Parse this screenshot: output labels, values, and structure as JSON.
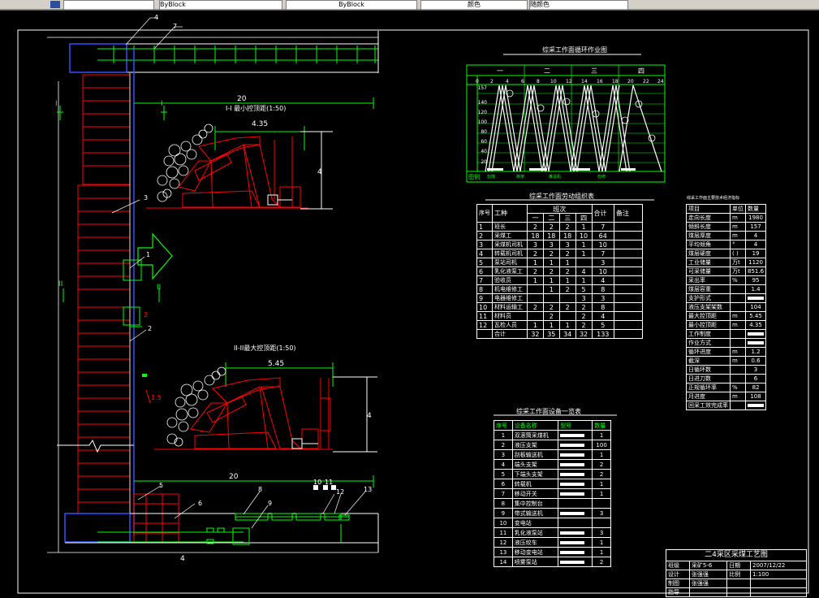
{
  "toolbar": {
    "combo1": "ByBlock",
    "combo2": "ByBlock",
    "combo3": "颜色",
    "combo4": "随颜色"
  },
  "drawing": {
    "dim_top": "20",
    "dim_bottom": "20",
    "dim_left_bottom": "4",
    "dim_small_h": "4",
    "dim_large_h": "4",
    "dim_small_w": "4.35",
    "dim_large_w": "5.45",
    "dim_small_gap": "2",
    "dim_gap2": "1.5",
    "section1_title": "I-I 最小控顶距(1:50)",
    "section2_title": "II-II最大控顶距(1:50)",
    "section1_mark_l": "I",
    "section1_mark_r": "I",
    "section2_mark_l": "II",
    "section2_mark_r": "II",
    "callouts": [
      "4",
      "7",
      "3",
      "1",
      "2",
      "5",
      "6",
      "8",
      "9",
      "10",
      "11",
      "12",
      "13"
    ]
  },
  "cycle_chart": {
    "title": "综采工作面循环作业图",
    "shifts": [
      "一",
      "二",
      "三",
      "四"
    ],
    "hours": [
      "0",
      "2",
      "4",
      "6",
      "8",
      "10",
      "12",
      "14",
      "16",
      "18",
      "20",
      "22",
      "24"
    ],
    "y_ticks": [
      "157",
      "140",
      "120",
      "100",
      "80",
      "60",
      "40",
      "20"
    ],
    "legend_label": "图例",
    "legend_items": [
      "割煤",
      "移架",
      "推溜机",
      "检修"
    ]
  },
  "labor_table": {
    "title": "综采工作面劳动组织表",
    "header": {
      "seq": "序号",
      "job": "工种",
      "shifts": "班次",
      "shift_cols": [
        "一",
        "二",
        "三",
        "四"
      ],
      "total": "合计",
      "note": "备注"
    },
    "rows": [
      [
        "1",
        "班长",
        "2",
        "2",
        "2",
        "1",
        "7"
      ],
      [
        "2",
        "采煤工",
        "18",
        "18",
        "18",
        "10",
        "64"
      ],
      [
        "3",
        "采煤机司机",
        "3",
        "3",
        "3",
        "1",
        "10"
      ],
      [
        "4",
        "转载机司机",
        "2",
        "2",
        "2",
        "1",
        "7"
      ],
      [
        "5",
        "泵站司机",
        "1",
        "1",
        "1",
        "",
        "3"
      ],
      [
        "6",
        "乳化液泵工",
        "2",
        "2",
        "2",
        "4",
        "10"
      ],
      [
        "7",
        "验收员",
        "1",
        "1",
        "1",
        "1",
        "4"
      ],
      [
        "8",
        "机电维修工",
        "",
        "1",
        "2",
        "5",
        "8"
      ],
      [
        "9",
        "电器维修工",
        "",
        "",
        "",
        "3",
        "3"
      ],
      [
        "10",
        "材料运输工",
        "2",
        "2",
        "2",
        "2",
        "8"
      ],
      [
        "11",
        "材料员",
        "",
        "2",
        "",
        "2",
        "4"
      ],
      [
        "12",
        "瓦检人员",
        "1",
        "1",
        "1",
        "2",
        "5"
      ],
      [
        "",
        "合计",
        "32",
        "35",
        "34",
        "32",
        "133"
      ]
    ]
  },
  "tech_table": {
    "title": "综采工作面主要技术经济指标",
    "header": [
      "项目",
      "单位",
      "数量"
    ],
    "rows": [
      [
        "走向长度",
        "m",
        "1980"
      ],
      [
        "倾斜长度",
        "m",
        "157"
      ],
      [
        "煤层厚度",
        "m",
        "4"
      ],
      [
        "平均倾角",
        "°",
        "4"
      ],
      [
        "煤层硬度",
        "( )",
        "19"
      ],
      [
        "工业储量",
        "万t",
        "1120"
      ],
      [
        "可采储量",
        "万t",
        "851.6"
      ],
      [
        "采出率",
        "%",
        "95"
      ],
      [
        "煤层容重",
        "",
        "1.4"
      ],
      [
        "支护形式",
        "",
        ""
      ],
      [
        "液压支架架数",
        "",
        "104"
      ],
      [
        "最大控顶距",
        "m",
        "5.45"
      ],
      [
        "最小控顶距",
        "m",
        "4.35"
      ],
      [
        "工作制度",
        "",
        ""
      ],
      [
        "作业方式",
        "",
        ""
      ],
      [
        "循环进度",
        "m",
        "1.2"
      ],
      [
        "截深",
        "m",
        "0.6"
      ],
      [
        "日循环数",
        "",
        "3"
      ],
      [
        "日进刀数",
        "",
        "6"
      ],
      [
        "正规循环率",
        "%",
        "82"
      ],
      [
        "月进度",
        "m",
        "108"
      ],
      [
        "回采工效完成率",
        "",
        ""
      ]
    ]
  },
  "equip_table": {
    "title": "综采工作面设备一览表",
    "header": [
      "序号",
      "设备名称",
      "型号",
      "数量"
    ],
    "rows": [
      [
        "1",
        "双滚筒采煤机",
        "",
        "1"
      ],
      [
        "2",
        "液压支架",
        "",
        "100"
      ],
      [
        "3",
        "刮板输送机",
        "",
        "1"
      ],
      [
        "4",
        "端头支架",
        "",
        "2"
      ],
      [
        "5",
        "下端头支架",
        "",
        "2"
      ],
      [
        "6",
        "转载机",
        "",
        "1"
      ],
      [
        "7",
        "移动开关",
        "",
        "1"
      ],
      [
        "8",
        "集中控制台",
        "",
        ""
      ],
      [
        "9",
        "带式输送机",
        "",
        "3"
      ],
      [
        "10",
        "变电站",
        "",
        ""
      ],
      [
        "11",
        "乳化液泵站",
        "",
        "3"
      ],
      [
        "12",
        "液压绞车",
        "",
        "1"
      ],
      [
        "13",
        "移动变电站",
        "",
        "1"
      ],
      [
        "14",
        "喷雾泵站",
        "",
        "2"
      ]
    ]
  },
  "title_block": {
    "title": "二4采区采煤工艺图",
    "row1": [
      "班级",
      "采矿5-6",
      "日期",
      "2007/12/22"
    ],
    "row2": [
      "设计",
      "张强强",
      "比例",
      "1:100"
    ],
    "row3": [
      "制图",
      "张强强",
      "",
      ""
    ],
    "row4": [
      "指导",
      "",
      "",
      ""
    ]
  }
}
